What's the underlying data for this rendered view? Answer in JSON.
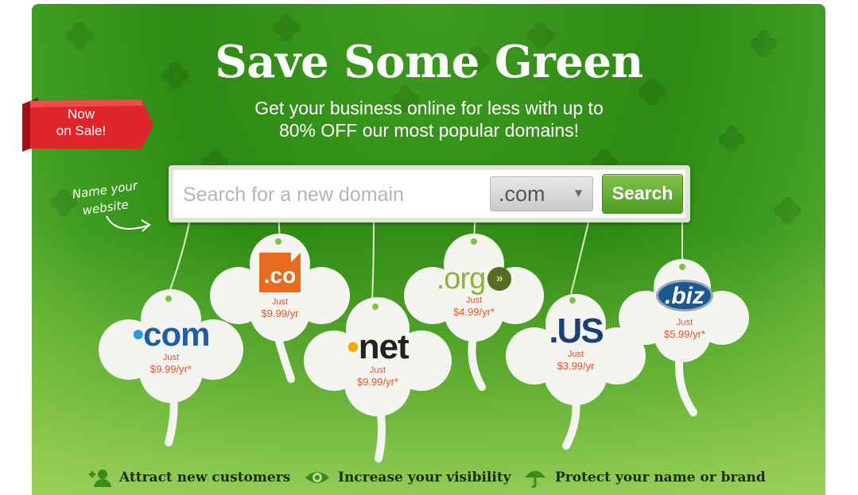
{
  "banner": {
    "headline": "Save Some Green",
    "subline_1": "Get your business online for less with up to",
    "subline_2": "80% OFF our most popular domains!",
    "ribbon_line_1": "Now",
    "ribbon_line_2": "on Sale!",
    "handwritten_line_1": "Name your",
    "handwritten_line_2": "website",
    "colors": {
      "background": "#2e8a14",
      "ribbon": "#e0262b",
      "price": "#e8532a",
      "button": "#5fa830"
    }
  },
  "search": {
    "placeholder": "Search for a new domain",
    "value": "",
    "tld_selected": ".com",
    "button_label": "Search"
  },
  "domains": [
    {
      "tld": ".com",
      "logo_main": "com",
      "just_label": "Just",
      "price": "$9.99/yr*"
    },
    {
      "tld": ".co",
      "logo_main": ".co",
      "just_label": "Just",
      "price": "$9.99/yr"
    },
    {
      "tld": ".net",
      "logo_main": "net",
      "just_label": "Just",
      "price": "$9.99/yr*"
    },
    {
      "tld": ".org",
      "logo_main": ".org",
      "just_label": "Just",
      "price": "$4.99/yr*"
    },
    {
      "tld": ".US",
      "logo_main": ".US",
      "just_label": "Just",
      "price": "$3.99/yr"
    },
    {
      "tld": ".biz",
      "logo_main": ".biz",
      "just_label": "Just",
      "price": "$5.99/yr*"
    }
  ],
  "features": [
    {
      "icon": "add-user-icon",
      "label": "Attract new customers"
    },
    {
      "icon": "eye-icon",
      "label": "Increase your visibility"
    },
    {
      "icon": "umbrella-icon",
      "label": "Protect your name or brand"
    }
  ]
}
